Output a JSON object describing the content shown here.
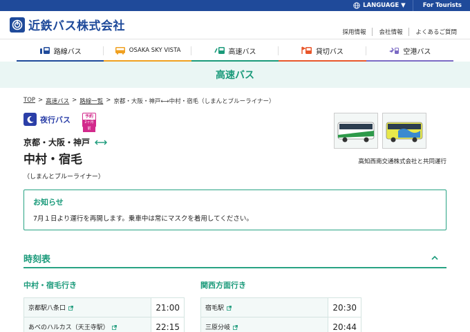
{
  "topbar": {
    "language_label": "LANGUAGE ▼",
    "tourists_label": "For Tourists"
  },
  "header": {
    "logo_text": "近鉄バス株式会社",
    "util_links": [
      "採用情報",
      "会社情報",
      "よくあるご質問"
    ]
  },
  "nav": {
    "items": [
      {
        "label": "路線バス",
        "icon": "route-bus-icon",
        "color": "#1f4a9a"
      },
      {
        "label": "OSAKA SKY VISTA",
        "icon": "sky-vista-bus-icon",
        "color": "#f0a020"
      },
      {
        "label": "高速バス",
        "icon": "highway-bus-icon",
        "color": "#1a9a7a"
      },
      {
        "label": "貸切バス",
        "icon": "charter-bus-icon",
        "color": "#e8562a"
      },
      {
        "label": "空港バス",
        "icon": "airport-bus-icon",
        "color": "#7b6ac4"
      }
    ]
  },
  "banner": {
    "title": "高速バス"
  },
  "breadcrumb": {
    "items": [
      "TOP",
      "高速バス",
      "路線一覧"
    ],
    "separator": ">",
    "current": "京都・大阪・神戸⟷中村・宿毛（しまんとブルーライナー）"
  },
  "route": {
    "type_label": "夜行バス",
    "reserve_top": "予約",
    "reserve_bottom": "2ヶ月前",
    "from": "京都・大阪・神戸",
    "to": "中村・宿毛",
    "subtitle": "（しまんとブルーライナー）",
    "joint_operation": "高知西南交通株式会社と共同運行"
  },
  "notice": {
    "title": "お知らせ",
    "body": "7月１日より運行を再開します。乗車中は常にマスクを着用してください。"
  },
  "timetable": {
    "title": "時刻表",
    "directions": [
      {
        "title": "中村・宿毛行き",
        "stops": [
          {
            "name": "京都駅八条口",
            "time": "21:00"
          },
          {
            "name": "あべのハルカス（天王寺駅）",
            "time": "22:15"
          }
        ]
      },
      {
        "title": "関西方面行き",
        "stops": [
          {
            "name": "宿毛駅",
            "time": "20:30"
          },
          {
            "name": "三原分岐",
            "time": "20:44"
          }
        ]
      }
    ]
  },
  "colors": {
    "brand": "#1f4a9a",
    "accent": "#1a9a7a",
    "reserve": "#d22a8c",
    "night": "#2b3fa8"
  }
}
